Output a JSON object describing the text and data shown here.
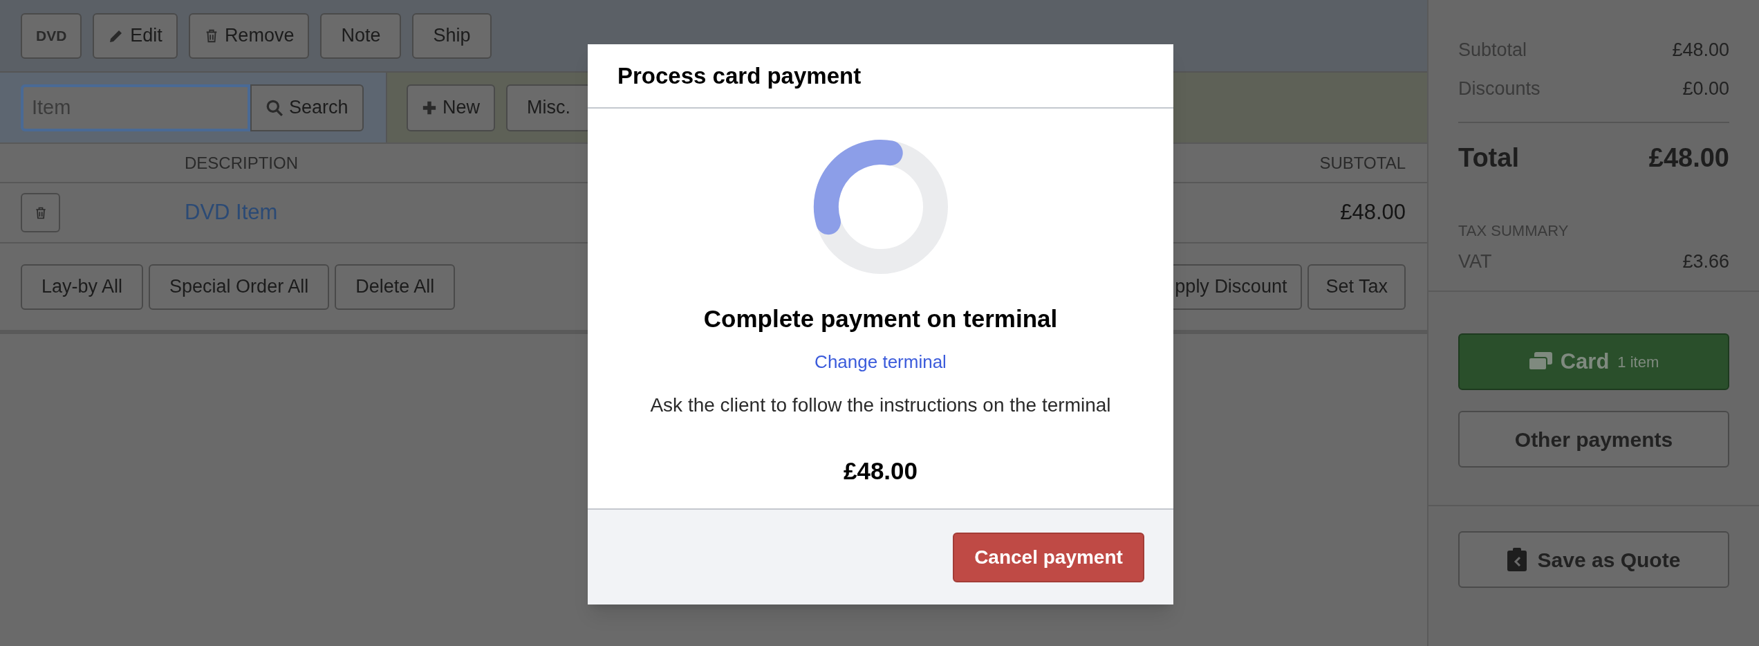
{
  "toolbar": {
    "buttons": [
      {
        "label": "DVD",
        "kind": "tag"
      },
      {
        "label": "Edit",
        "kind": "edit"
      },
      {
        "label": "Remove",
        "kind": "remove"
      },
      {
        "label": "Note",
        "kind": "plain"
      },
      {
        "label": "Ship",
        "kind": "plain"
      }
    ]
  },
  "search": {
    "placeholder": "Item",
    "button": "Search"
  },
  "add_actions": [
    {
      "label": "New",
      "kind": "add"
    },
    {
      "label": "Misc.",
      "kind": "plain"
    }
  ],
  "table": {
    "columns": [
      "DESCRIPTION",
      "SUBTOTAL"
    ],
    "rows": [
      {
        "description": "DVD Item",
        "subtotal": "£48.00"
      }
    ]
  },
  "bulk_actions": [
    "Lay-by All",
    "Special Order All",
    "Delete All"
  ],
  "line_actions": [
    "pply Discount",
    "Set Tax"
  ],
  "summary": {
    "rows": [
      {
        "label": "Subtotal",
        "value": "£48.00"
      },
      {
        "label": "Discounts",
        "value": "£0.00"
      }
    ],
    "total": {
      "label": "Total",
      "value": "£48.00"
    },
    "tax_summary": {
      "title": "TAX SUMMARY",
      "rows": [
        {
          "label": "VAT",
          "value": "£3.66"
        }
      ]
    }
  },
  "payments": {
    "card": {
      "label": "Card",
      "count": "1 item"
    },
    "other": "Other payments",
    "quote": "Save as Quote"
  },
  "modal": {
    "title": "Process card payment",
    "heading": "Complete payment on terminal",
    "link": "Change terminal",
    "message": "Ask the client to follow the instructions on the terminal",
    "amount": "£48.00",
    "cancel": "Cancel payment"
  }
}
